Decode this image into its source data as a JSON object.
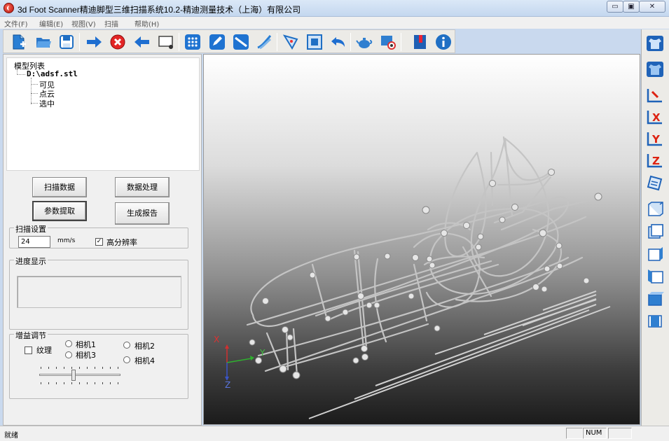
{
  "window": {
    "title": "3d Foot Scanner精迪脚型三维扫描系统10.2-精迪测量技术（上海）有限公司",
    "min_label": "▭",
    "max_label": "▣",
    "close_label": "✕"
  },
  "menu": [
    "文件(F)",
    "编辑(E)",
    "视图(V)",
    "扫描",
    "帮助(H)"
  ],
  "toolbar": {
    "icons": [
      "new-file-icon",
      "open-folder-icon",
      "save-icon",
      "arrow-right-icon",
      "stop-icon",
      "arrow-left-icon",
      "screen-icon",
      "dots-grid-icon",
      "edit-icon",
      "slope-icon",
      "stripes-icon",
      "triangle-select-icon",
      "frame-select-icon",
      "undo-icon",
      "teapot-icon",
      "view-eye-icon",
      "book-icon",
      "info-icon"
    ]
  },
  "right_toolbar": {
    "icons": [
      "shirt-front-icon",
      "shirt-back-icon",
      "axis-cursor-icon",
      "axis-x-icon",
      "axis-y-icon",
      "axis-z-icon",
      "notes-icon",
      "cube-front-icon",
      "cube-back-icon",
      "cube-right-icon",
      "cube-left-icon",
      "cube-top-icon",
      "cube-bottom-icon"
    ]
  },
  "tree": {
    "root": "模型列表",
    "file": "D:\\adsf.stl",
    "children": [
      "可见",
      "点云",
      "选中"
    ]
  },
  "buttons": {
    "scan_data": "扫描数据",
    "data_process": "数据处理",
    "param_extract": "参数提取",
    "gen_report": "生成报告"
  },
  "scan_settings": {
    "legend": "扫描设置",
    "speed_value": "24",
    "unit": "mm/s",
    "high_res_checked": "✓",
    "high_res_label": "高分辨率"
  },
  "progress": {
    "legend": "进度显示"
  },
  "gain": {
    "legend": "增益调节",
    "texture_label": "纹理",
    "cam1": "相机1",
    "cam2": "相机2",
    "cam3": "相机3",
    "cam4": "相机4",
    "slider_level": 0.42
  },
  "axes": {
    "x": "X",
    "y": "Y",
    "z": "Z"
  },
  "statusbar": {
    "ready": "就绪",
    "num": "NUM"
  }
}
